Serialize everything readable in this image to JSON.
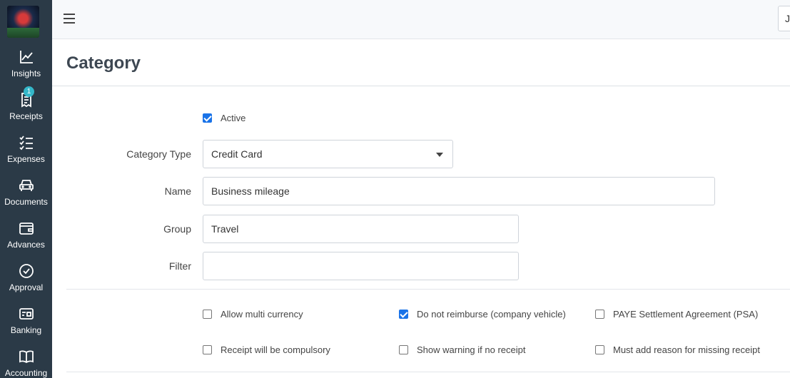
{
  "sidebar": {
    "items": [
      {
        "label": "Insights",
        "icon": "chart-line-icon"
      },
      {
        "label": "Receipts",
        "icon": "receipt-icon",
        "badge": "1"
      },
      {
        "label": "Expenses",
        "icon": "checklist-icon"
      },
      {
        "label": "Documents",
        "icon": "car-icon"
      },
      {
        "label": "Advances",
        "icon": "wallet-icon"
      },
      {
        "label": "Approval",
        "icon": "check-circle-icon"
      },
      {
        "label": "Banking",
        "icon": "bank-card-icon"
      },
      {
        "label": "Accounting",
        "icon": "book-icon"
      }
    ]
  },
  "topbar": {
    "user_text": "Jo"
  },
  "page": {
    "title": "Category"
  },
  "form": {
    "active": {
      "label": "Active",
      "checked": true
    },
    "category_type": {
      "label": "Category Type",
      "value": "Credit Card"
    },
    "name": {
      "label": "Name",
      "value": "Business mileage"
    },
    "group": {
      "label": "Group",
      "value": "Travel"
    },
    "filter": {
      "label": "Filter",
      "value": ""
    }
  },
  "options": {
    "allow_multi_currency": {
      "label": "Allow multi currency",
      "checked": false
    },
    "do_not_reimburse": {
      "label": "Do not reimburse (company vehicle)",
      "checked": true
    },
    "paye_settlement": {
      "label": "PAYE Settlement Agreement (PSA)",
      "checked": false
    },
    "receipt_compulsory": {
      "label": "Receipt will be compulsory",
      "checked": false
    },
    "show_warning": {
      "label": "Show warning if no receipt",
      "checked": false
    },
    "must_add_reason": {
      "label": "Must add reason for missing receipt",
      "checked": false
    }
  },
  "colors": {
    "sidebar_bg": "#2b3a47",
    "accent": "#1a73e8",
    "badge": "#34b7c9"
  }
}
